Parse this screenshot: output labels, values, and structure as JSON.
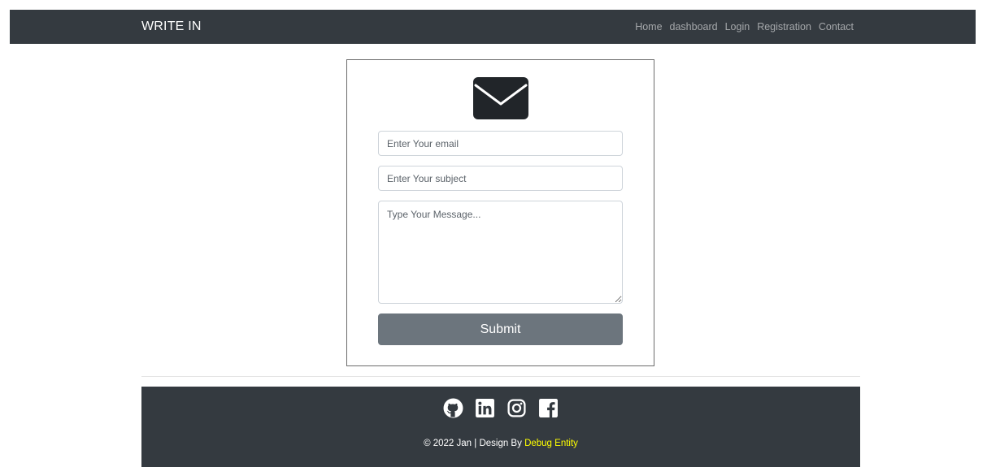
{
  "navbar": {
    "brand": "WRITE IN",
    "links": [
      "Home",
      "dashboard",
      "Login",
      "Registration",
      "Contact"
    ]
  },
  "contact_form": {
    "icon": "envelope-icon",
    "email_placeholder": "Enter Your email",
    "subject_placeholder": "Enter Your subject",
    "message_placeholder": "Type Your Message...",
    "submit_label": "Submit"
  },
  "footer": {
    "social_icons": [
      "github-icon",
      "linkedin-icon",
      "instagram-icon",
      "facebook-icon"
    ],
    "copyright_text": "© 2022 Jan | Design By",
    "credit_link": "Debug Entity"
  },
  "colors": {
    "navbar_bg": "#343a40",
    "button_bg": "#6c757d",
    "credit_link": "#ffff00"
  }
}
